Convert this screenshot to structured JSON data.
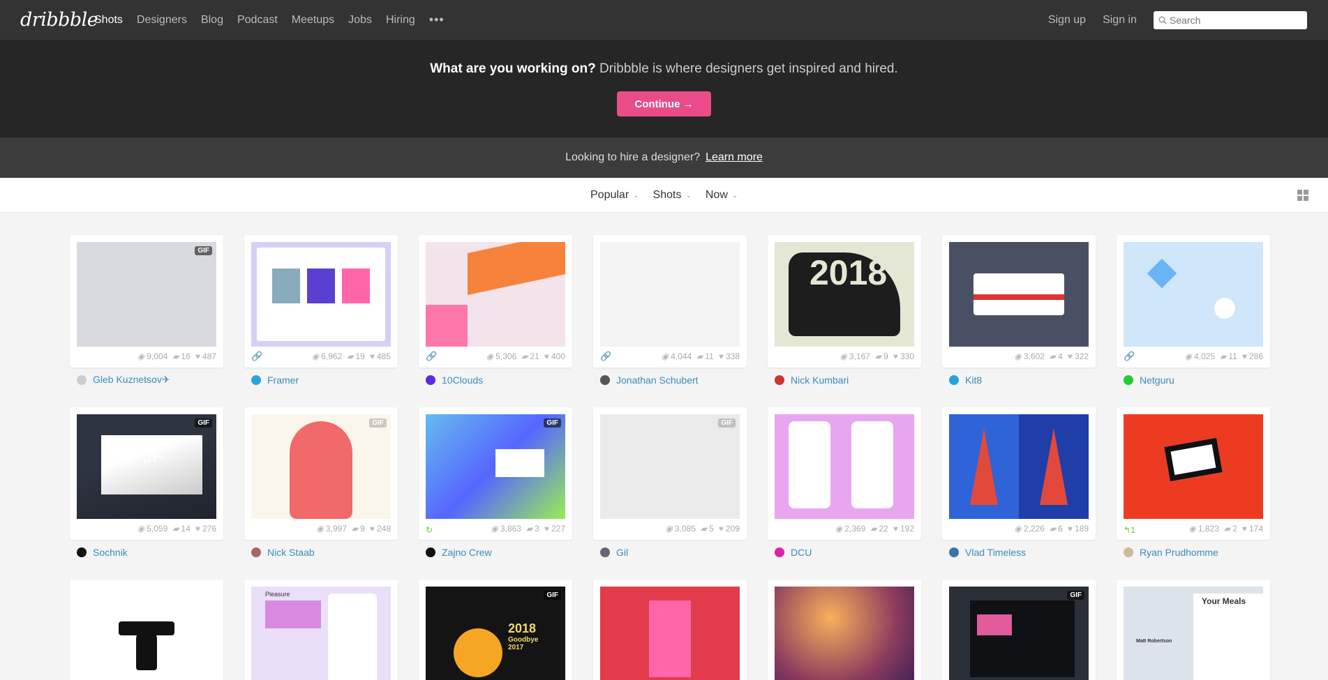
{
  "nav": {
    "logo": "dribbble",
    "links": [
      "Shots",
      "Designers",
      "Blog",
      "Podcast",
      "Meetups",
      "Jobs",
      "Hiring"
    ],
    "more": "•••",
    "signup": "Sign up",
    "signin": "Sign in",
    "search_placeholder": "Search"
  },
  "hero": {
    "question": "What are you working on?",
    "tagline": " Dribbble is where designers get inspired and hired.",
    "cta": "Continue →"
  },
  "hire": {
    "text": "Looking to hire a designer?",
    "link": "Learn more"
  },
  "filters": {
    "sort": "Popular",
    "type": "Shots",
    "time": "Now"
  },
  "shots": [
    {
      "author": "Gleb Kuznetsov✈",
      "views": "9,004",
      "comments": "16",
      "likes": "487",
      "gif": true,
      "link": false,
      "bg": "#d9d9e0",
      "avatar": "#ccc"
    },
    {
      "author": "Framer",
      "views": "6,962",
      "comments": "19",
      "likes": "485",
      "gif": false,
      "link": true,
      "bg": "#d6cff8",
      "avatar": "#29a3e0"
    },
    {
      "author": "10Clouds",
      "views": "5,306",
      "comments": "21",
      "likes": "400",
      "gif": false,
      "link": true,
      "bg": "#f3e4ec",
      "avatar": "#5b2be0"
    },
    {
      "author": "Jonathan Schubert",
      "views": "4,044",
      "comments": "11",
      "likes": "338",
      "gif": false,
      "link": true,
      "bg": "#f4f4f4",
      "avatar": "#555"
    },
    {
      "author": "Nick Kumbari",
      "views": "3,167",
      "comments": "9",
      "likes": "330",
      "gif": false,
      "link": false,
      "bg": "#e3e7d3",
      "avatar": "#c33"
    },
    {
      "author": "Kit8",
      "views": "3,602",
      "comments": "4",
      "likes": "322",
      "gif": false,
      "link": false,
      "bg": "#4a5064",
      "avatar": "#22a6d6"
    },
    {
      "author": "Netguru",
      "views": "4,025",
      "comments": "11",
      "likes": "286",
      "gif": false,
      "link": true,
      "bg": "#cfe6fb",
      "avatar": "#2c3"
    },
    {
      "author": "Sochnik",
      "views": "5,059",
      "comments": "14",
      "likes": "276",
      "gif": true,
      "link": false,
      "bg": "#2e3340",
      "avatar": "#111"
    },
    {
      "author": "Nick Staab",
      "views": "3,997",
      "comments": "9",
      "likes": "248",
      "gif": true,
      "gif_light": true,
      "link": false,
      "bg": "#fbf6ec",
      "avatar": "#a66"
    },
    {
      "author": "Zajno Crew",
      "views": "3,863",
      "comments": "3",
      "likes": "227",
      "gif": true,
      "link": false,
      "rebound": true,
      "bg": "#7fde88",
      "avatar": "#111"
    },
    {
      "author": "Gil",
      "views": "3,085",
      "comments": "5",
      "likes": "209",
      "gif": true,
      "gif_light": true,
      "link": false,
      "bg": "#eaeaea",
      "avatar": "#667"
    },
    {
      "author": "DCU",
      "views": "2,369",
      "comments": "22",
      "likes": "192",
      "gif": false,
      "link": false,
      "bg": "#e9a6f0",
      "avatar": "#d2a"
    },
    {
      "author": "Vlad Timeless",
      "views": "2,226",
      "comments": "6",
      "likes": "189",
      "gif": false,
      "link": false,
      "bg": "#1f3ea8",
      "avatar": "#37a"
    },
    {
      "author": "Ryan Prudhomme",
      "views": "1,823",
      "comments": "2",
      "likes": "174",
      "gif": false,
      "link": false,
      "rebound_count": "1",
      "bg": "#ed3b22",
      "avatar": "#cb9"
    },
    {
      "author": "",
      "views": "",
      "comments": "",
      "likes": "",
      "gif": false,
      "link": false,
      "bg": "#ffffff",
      "avatar": ""
    },
    {
      "author": "",
      "views": "",
      "comments": "",
      "likes": "",
      "gif": false,
      "link": false,
      "bg": "#eadff9",
      "avatar": ""
    },
    {
      "author": "",
      "views": "",
      "comments": "",
      "likes": "",
      "gif": true,
      "link": false,
      "bg": "#141414",
      "avatar": ""
    },
    {
      "author": "",
      "views": "",
      "comments": "",
      "likes": "",
      "gif": false,
      "link": false,
      "bg": "#e23c4c",
      "avatar": ""
    },
    {
      "author": "",
      "views": "",
      "comments": "",
      "likes": "",
      "gif": false,
      "link": false,
      "bg": "#8a3b5e",
      "avatar": ""
    },
    {
      "author": "",
      "views": "",
      "comments": "",
      "likes": "",
      "gif": true,
      "link": false,
      "bg": "#2b2f37",
      "avatar": ""
    },
    {
      "author": "",
      "views": "",
      "comments": "",
      "likes": "",
      "gif": false,
      "link": false,
      "bg": "#dce3ea",
      "avatar": ""
    }
  ],
  "thumb_text": {
    "t2018": "2018",
    "goodbye": "Goodbye 2017",
    "your_meals": "Your Meals",
    "matt": "Matt Robertson",
    "pleasure": "Pleasure",
    "jf": "JF"
  },
  "gif_label": "GIF",
  "colors": {
    "accent": "#ea4c89",
    "link": "#3a8bbb",
    "nav_bg": "#333333"
  }
}
